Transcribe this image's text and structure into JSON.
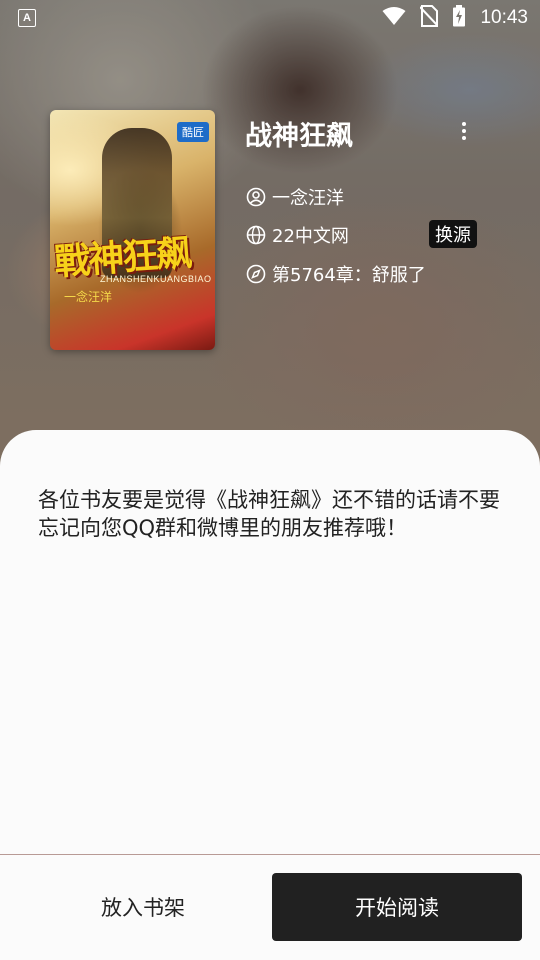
{
  "status_bar": {
    "time": "10:43",
    "left_icon": "a-notification-icon",
    "icons": [
      "wifi-icon",
      "no-sim-icon",
      "battery-charging-icon"
    ]
  },
  "book": {
    "title": "战神狂飙",
    "author": "一念汪洋",
    "source": "22中文网",
    "latest_chapter": "第5764章：舒服了",
    "switch_source_label": "换源",
    "cover": {
      "publisher": "酷匠",
      "title_art": "戰神狂飙",
      "pinyin": "ZHANSHENKUANGBIAO",
      "author_art": "一念汪洋"
    }
  },
  "description": "各位书友要是觉得《战神狂飙》还不错的话请不要忘记向您QQ群和微博里的朋友推荐哦！",
  "actions": {
    "add_to_shelf": "放入书架",
    "start_reading": "开始阅读"
  },
  "colors": {
    "primary_button": "#212121",
    "sheet_background": "#fbfbfb",
    "divider": "#b89a95"
  }
}
